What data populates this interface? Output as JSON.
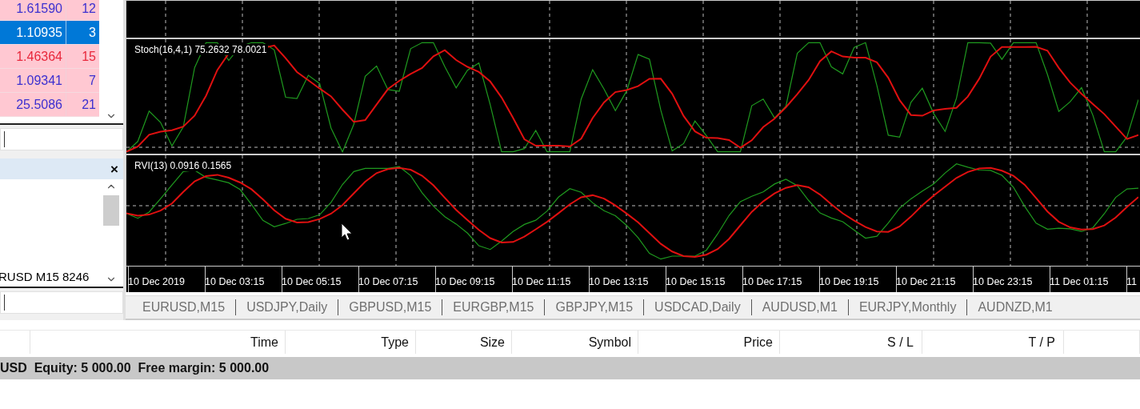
{
  "market_watch": {
    "rows": [
      {
        "bid": "1.61590",
        "spread": "12",
        "selected": false,
        "color": "#3b2fd0"
      },
      {
        "bid": "1.10935",
        "spread": "3",
        "selected": true
      },
      {
        "bid": "1.46364",
        "spread": "15",
        "selected": false,
        "color": "#e8283c"
      },
      {
        "bid": "1.09341",
        "spread": "7",
        "selected": false,
        "color": "#3b2fd0"
      },
      {
        "bid": "25.5086",
        "spread": "21",
        "selected": false,
        "color": "#3b2fd0"
      }
    ]
  },
  "navigator": {
    "close": "×",
    "items": [
      "RUSD M15 8246"
    ]
  },
  "chart": {
    "indicators": [
      {
        "kind": "stochastic",
        "label": "Stoch(16,4,1) 75.2632 78.0021"
      },
      {
        "kind": "rvi",
        "label": "RVI(13) 0.0916 0.1565"
      }
    ],
    "time_axis": [
      "10 Dec 2019",
      "10 Dec 03:15",
      "10 Dec 05:15",
      "10 Dec 07:15",
      "10 Dec 09:15",
      "10 Dec 11:15",
      "10 Dec 13:15",
      "10 Dec 15:15",
      "10 Dec 17:15",
      "10 Dec 19:15",
      "10 Dec 21:15",
      "10 Dec 23:15",
      "11 Dec 01:15",
      "11"
    ]
  },
  "chart_tabs": [
    "EURUSD,M15",
    "USDJPY,Daily",
    "GBPUSD,M15",
    "EURGBP,M15",
    "GBPJPY,M15",
    "USDCAD,Daily",
    "AUDUSD,M1",
    "EURJPY,Monthly",
    "AUDNZD,M1"
  ],
  "terminal": {
    "columns": [
      "Time",
      "Type",
      "Size",
      "Symbol",
      "Price",
      "S / L",
      "T / P"
    ],
    "status": "USD  Equity: 5 000.00  Free margin: 5 000.00"
  }
}
